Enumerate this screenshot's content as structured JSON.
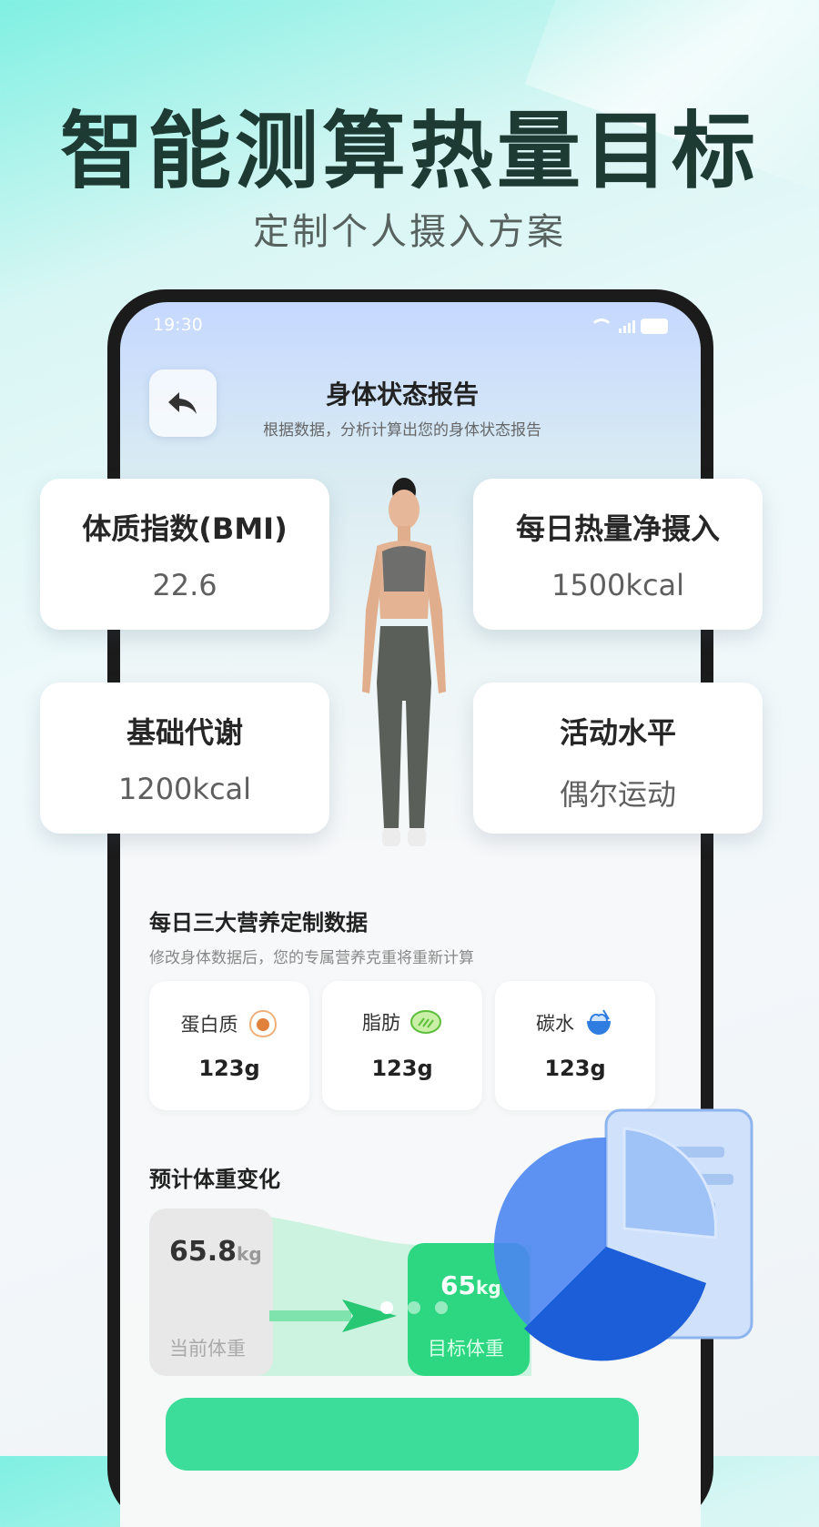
{
  "headline": "智能测算热量目标",
  "subline": "定制个人摄入方案",
  "status": {
    "time": "19:30"
  },
  "header": {
    "title": "身体状态报告",
    "subtitle": "根据数据，分析计算出您的身体状态报告"
  },
  "stats": {
    "bmi": {
      "label": "体质指数(BMI)",
      "value": "22.6"
    },
    "net_intake": {
      "label": "每日热量净摄入",
      "value": "1500kcal"
    },
    "bmr": {
      "label": "基础代谢",
      "value": "1200kcal"
    },
    "activity": {
      "label": "活动水平",
      "value": "偶尔运动"
    }
  },
  "nutrition": {
    "title": "每日三大营养定制数据",
    "subtitle": "修改身体数据后，您的专属营养克重将重新计算",
    "items": [
      {
        "label": "蛋白质",
        "value": "123g",
        "icon": "egg-icon"
      },
      {
        "label": "脂肪",
        "value": "123g",
        "icon": "avocado-icon"
      },
      {
        "label": "碳水",
        "value": "123g",
        "icon": "rice-bowl-icon"
      }
    ]
  },
  "weight": {
    "title": "预计体重变化",
    "current": {
      "value": "65.8",
      "unit": "kg",
      "label": "当前体重"
    },
    "target": {
      "value": "65",
      "unit": "kg",
      "label": "目标体重"
    }
  },
  "colors": {
    "accent": "#2dd782",
    "headline": "#1d3a33"
  }
}
